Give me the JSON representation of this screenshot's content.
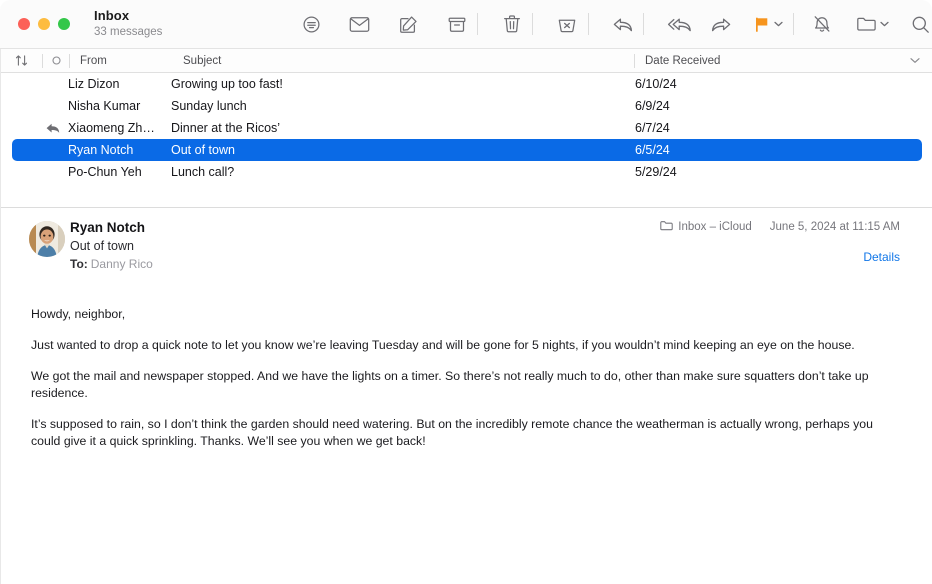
{
  "window": {
    "title": "Inbox",
    "subtitle": "33 messages",
    "traffic_lights": [
      "close",
      "minimize",
      "zoom"
    ]
  },
  "toolbar": {
    "items": [
      {
        "name": "filter-icon",
        "label": "Filter"
      },
      {
        "name": "mark-unread-icon",
        "label": "Mark as Unread"
      },
      {
        "name": "compose-icon",
        "label": "New Message"
      },
      {
        "name": "archive-icon",
        "label": "Archive"
      },
      {
        "name": "delete-icon",
        "label": "Delete"
      },
      {
        "name": "junk-icon",
        "label": "Move to Junk"
      },
      {
        "name": "reply-icon",
        "label": "Reply"
      },
      {
        "name": "reply-all-icon",
        "label": "Reply All"
      },
      {
        "name": "forward-icon",
        "label": "Forward"
      },
      {
        "name": "flag-icon",
        "label": "Flag"
      },
      {
        "name": "mute-icon",
        "label": "Mute"
      },
      {
        "name": "move-icon",
        "label": "Move"
      },
      {
        "name": "search-icon",
        "label": "Search"
      }
    ],
    "flag_color": "#f6941d",
    "accent_color": "#0a6ae6"
  },
  "list": {
    "columns": {
      "sort": "sort-icon",
      "unread": "unread-dot-icon",
      "from": "From",
      "subject": "Subject",
      "date": "Date Received"
    },
    "rows": [
      {
        "flag": "",
        "from": "Liz Dizon",
        "subject": "Growing up too fast!",
        "date": "6/10/24",
        "selected": false
      },
      {
        "flag": "",
        "from": "Nisha Kumar",
        "subject": "Sunday lunch",
        "date": "6/9/24",
        "selected": false
      },
      {
        "flag": "replied",
        "from": "Xiaomeng Zh…",
        "subject": "Dinner at the Ricos’",
        "date": "6/7/24",
        "selected": false
      },
      {
        "flag": "",
        "from": "Ryan Notch",
        "subject": "Out of town",
        "date": "6/5/24",
        "selected": true
      },
      {
        "flag": "",
        "from": "Po-Chun Yeh",
        "subject": "Lunch call?",
        "date": "5/29/24",
        "selected": false
      }
    ]
  },
  "message": {
    "sender": "Ryan Notch",
    "subject": "Out of town",
    "to_label": "To:",
    "to_value": "Danny Rico",
    "mailbox": "Inbox – iCloud",
    "timestamp": "June 5, 2024 at 11:15 AM",
    "details_link": "Details",
    "body": [
      "Howdy, neighbor,",
      "Just wanted to drop a quick note to let you know we’re leaving Tuesday and will be gone for 5 nights, if you wouldn’t mind keeping an eye on the house.",
      "We got the mail and newspaper stopped. And we have the lights on a timer. So there’s not really much to do, other than make sure squatters don’t take up residence.",
      "It’s supposed to rain, so I don’t think the garden should need watering. But on the incredibly remote chance the weatherman is actually wrong, perhaps you could give it a quick sprinkling. Thanks. We’ll see you when we get back!"
    ]
  }
}
